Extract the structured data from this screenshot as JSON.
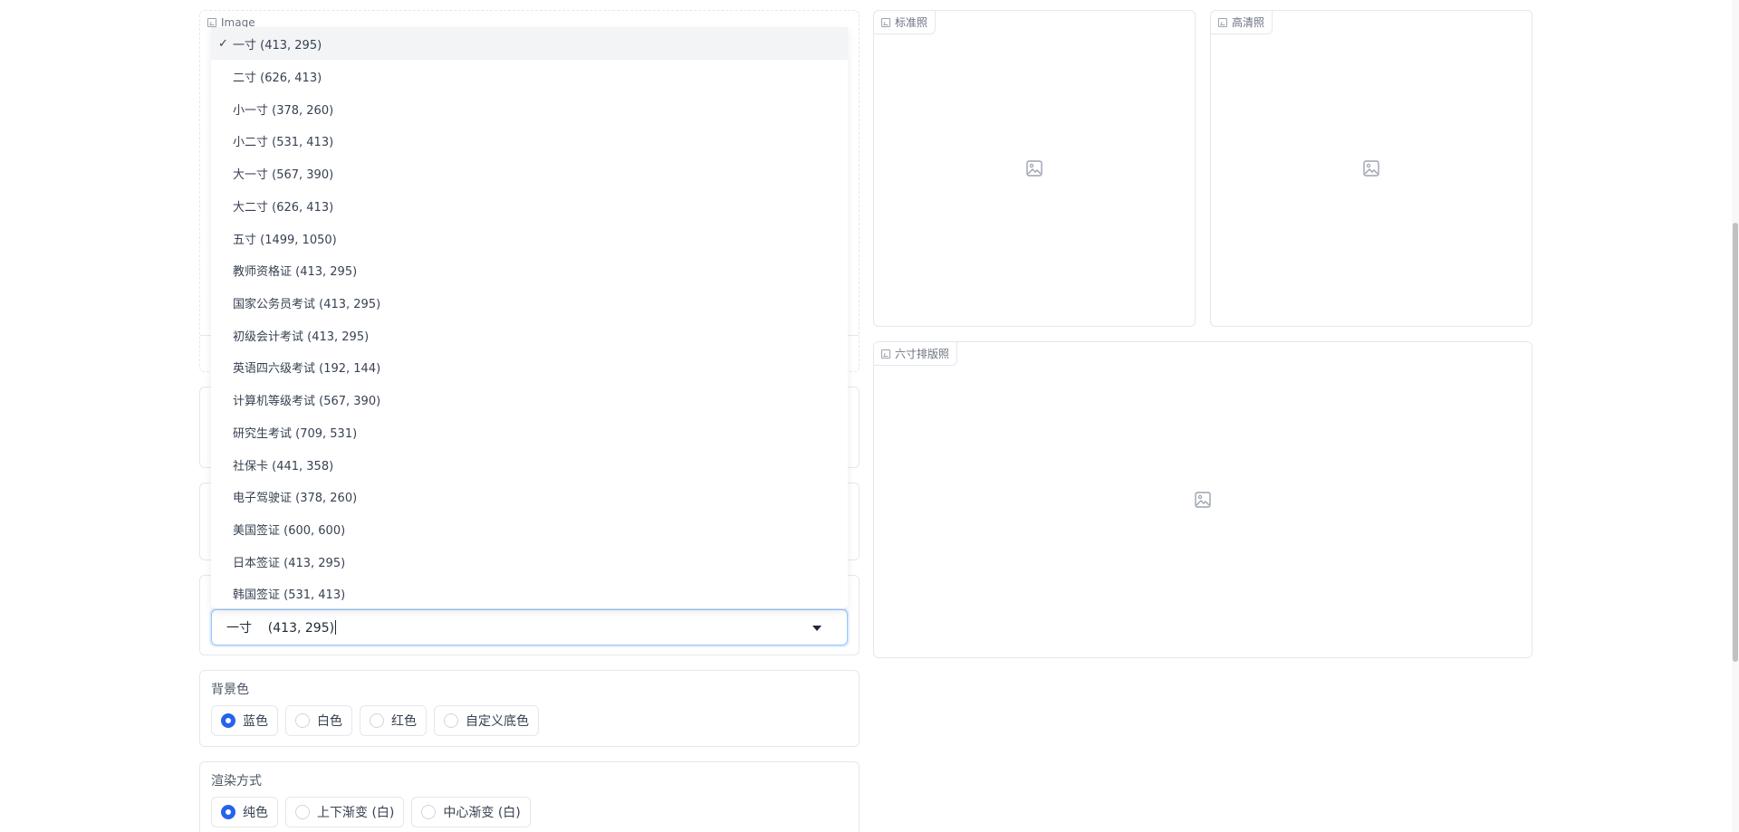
{
  "image_input": {
    "label": "Image"
  },
  "outputs": {
    "standard": {
      "label": "标准照"
    },
    "hd": {
      "label": "高清照"
    },
    "layout": {
      "label": "六寸排版照"
    }
  },
  "size_dropdown": {
    "options": [
      "一寸 (413, 295)",
      "二寸 (626, 413)",
      "小一寸 (378, 260)",
      "小二寸 (531, 413)",
      "大一寸 (567, 390)",
      "大二寸 (626, 413)",
      "五寸 (1499, 1050)",
      "教师资格证 (413, 295)",
      "国家公务员考试 (413, 295)",
      "初级会计考试 (413, 295)",
      "英语四六级考试 (192, 144)",
      "计算机等级考试 (567, 390)",
      "研究生考试 (709, 531)",
      "社保卡 (441, 358)",
      "电子驾驶证 (378, 260)",
      "美国签证 (600, 600)",
      "日本签证 (413, 295)",
      "韩国签证 (531, 413)"
    ],
    "check_mark": "✓",
    "selected_value": "一寸    (413, 295)"
  },
  "background_color": {
    "label": "背景色",
    "options": [
      "蓝色",
      "白色",
      "红色",
      "自定义底色"
    ],
    "selected_index": 0,
    "accent": "#2563eb"
  },
  "render_mode": {
    "label": "渲染方式",
    "options": [
      "纯色",
      "上下渐变 (白)",
      "中心渐变 (白)"
    ],
    "selected_index": 0
  }
}
